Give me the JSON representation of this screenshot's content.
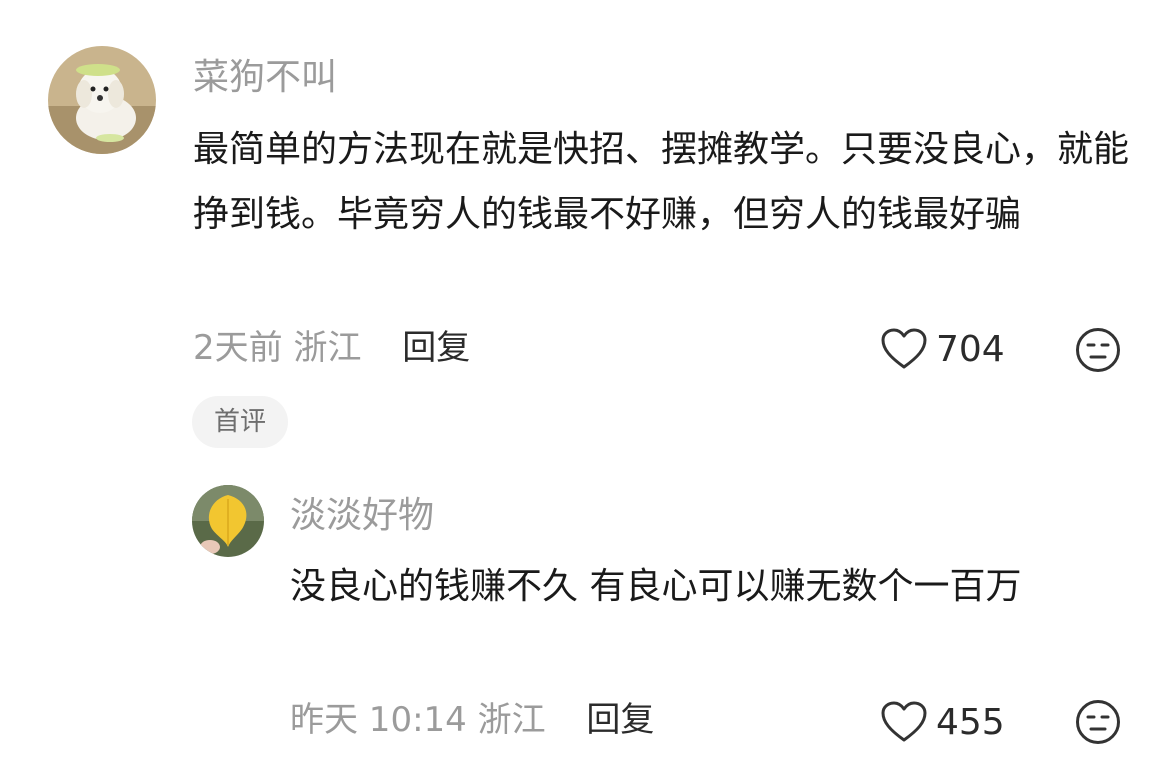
{
  "comment": {
    "username": "菜狗不叫",
    "text": "最简单的方法现在就是快招、摆摊教学。只要没良心，就能挣到钱。毕竟穷人的钱最不好赚，但穷人的钱最好骗",
    "time": "2天前",
    "location": "浙江",
    "reply_label": "回复",
    "likes": "704",
    "badge": "首评",
    "avatar_icon": "dog-avatar",
    "like_icon": "heart-outline-icon",
    "dislike_icon": "unamused-face-icon"
  },
  "reply": {
    "username": "淡淡好物",
    "text": "没良心的钱赚不久 有良心可以赚无数个一百万",
    "time": "昨天 10:14",
    "location": "浙江",
    "reply_label": "回复",
    "likes": "455",
    "avatar_icon": "yellow-leaf-avatar",
    "like_icon": "heart-outline-icon",
    "dislike_icon": "unamused-face-icon"
  },
  "colors": {
    "username": "#9b9b9b",
    "text": "#1a1a1a",
    "meta": "#9b9b9b",
    "badge_bg": "#f3f3f3"
  }
}
